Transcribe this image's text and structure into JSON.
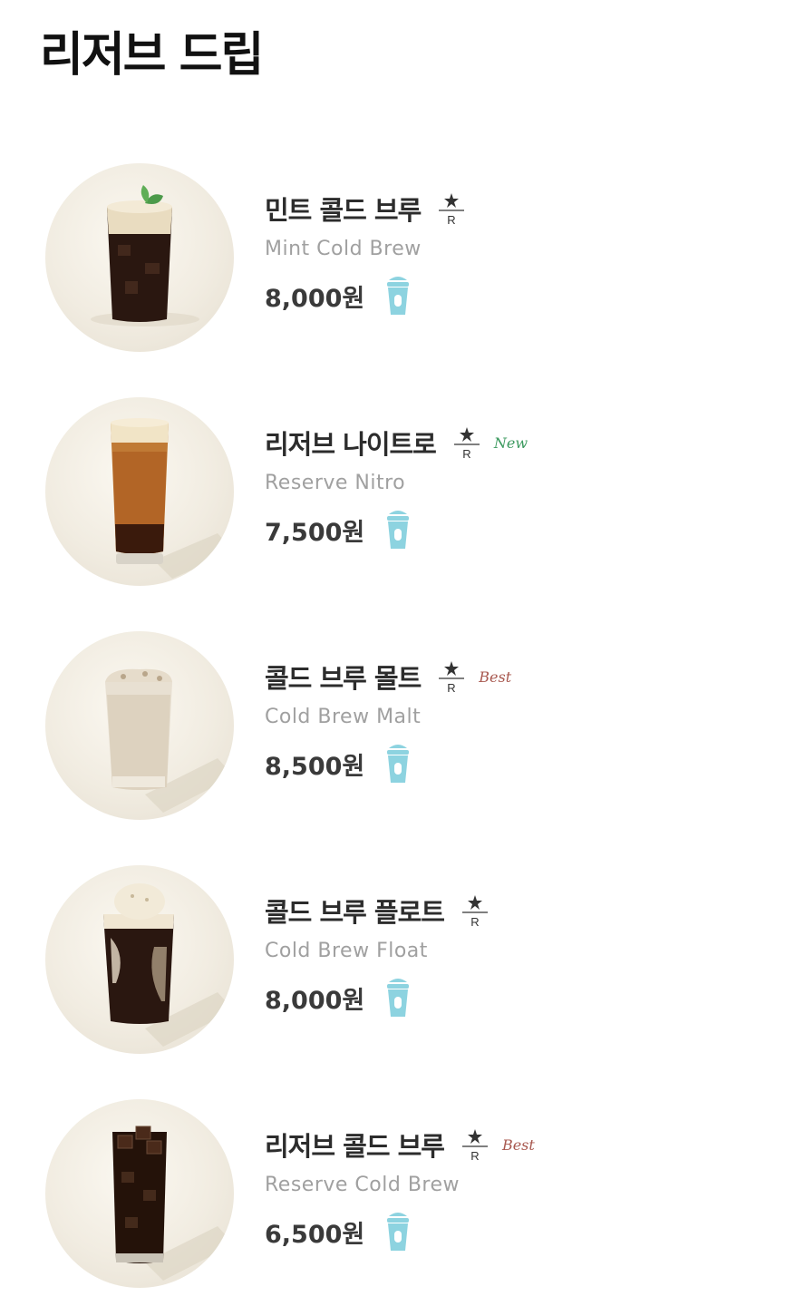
{
  "page": {
    "title": "리저브 드립"
  },
  "colors": {
    "new_tag": "#3c9a5f",
    "best_tag": "#a8584f",
    "cup_icon": "#8dd3e0"
  },
  "items": [
    {
      "name_ko": "민트 콜드 브루",
      "name_en": "Mint Cold Brew",
      "price": "8,000원",
      "tag": "",
      "reserve_mark": "R",
      "icons": [
        "reserve-star-icon",
        "iced-cup-icon"
      ]
    },
    {
      "name_ko": "리저브 나이트로",
      "name_en": "Reserve Nitro",
      "price": "7,500원",
      "tag": "New",
      "reserve_mark": "R",
      "icons": [
        "reserve-star-icon",
        "iced-cup-icon"
      ]
    },
    {
      "name_ko": "콜드 브루 몰트",
      "name_en": "Cold Brew Malt",
      "price": "8,500원",
      "tag": "Best",
      "reserve_mark": "R",
      "icons": [
        "reserve-star-icon",
        "iced-cup-icon"
      ]
    },
    {
      "name_ko": "콜드 브루 플로트",
      "name_en": "Cold Brew Float",
      "price": "8,000원",
      "tag": "",
      "reserve_mark": "R",
      "icons": [
        "reserve-star-icon",
        "iced-cup-icon"
      ]
    },
    {
      "name_ko": "리저브 콜드 브루",
      "name_en": "Reserve Cold Brew",
      "price": "6,500원",
      "tag": "Best",
      "reserve_mark": "R",
      "icons": [
        "reserve-star-icon",
        "iced-cup-icon"
      ]
    }
  ]
}
